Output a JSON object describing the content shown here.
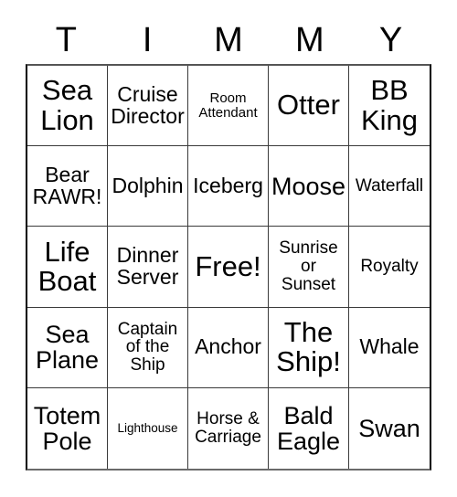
{
  "card": {
    "header_letters": [
      "T",
      "I",
      "M",
      "M",
      "Y"
    ],
    "free_space_label": "Free!",
    "columns": 5,
    "rows": 5,
    "text_color": "#000000",
    "background_color": "#ffffff",
    "border_color": "#3a3a3a"
  },
  "cells": [
    {
      "text": "Sea\nLion",
      "size": "xl"
    },
    {
      "text": "Cruise\nDirector",
      "size": "md"
    },
    {
      "text": "Room\nAttendant",
      "size": "xs"
    },
    {
      "text": "Otter",
      "size": "xl"
    },
    {
      "text": "BB\nKing",
      "size": "xl"
    },
    {
      "text": "Bear\nRAWR!",
      "size": "md"
    },
    {
      "text": "Dolphin",
      "size": "md"
    },
    {
      "text": "Iceberg",
      "size": "md"
    },
    {
      "text": "Moose",
      "size": "lg"
    },
    {
      "text": "Waterfall",
      "size": "sm"
    },
    {
      "text": "Life\nBoat",
      "size": "xl"
    },
    {
      "text": "Dinner\nServer",
      "size": "md"
    },
    {
      "text": "Free!",
      "size": "xl"
    },
    {
      "text": "Sunrise\nor\nSunset",
      "size": "sm"
    },
    {
      "text": "Royalty",
      "size": "sm"
    },
    {
      "text": "Sea\nPlane",
      "size": "lg"
    },
    {
      "text": "Captain\nof the\nShip",
      "size": "sm"
    },
    {
      "text": "Anchor",
      "size": "md"
    },
    {
      "text": "The\nShip!",
      "size": "xl"
    },
    {
      "text": "Whale",
      "size": "md"
    },
    {
      "text": "Totem\nPole",
      "size": "lg"
    },
    {
      "text": "Lighthouse",
      "size": "xxs"
    },
    {
      "text": "Horse &\nCarriage",
      "size": "sm"
    },
    {
      "text": "Bald\nEagle",
      "size": "lg"
    },
    {
      "text": "Swan",
      "size": "lg"
    }
  ]
}
